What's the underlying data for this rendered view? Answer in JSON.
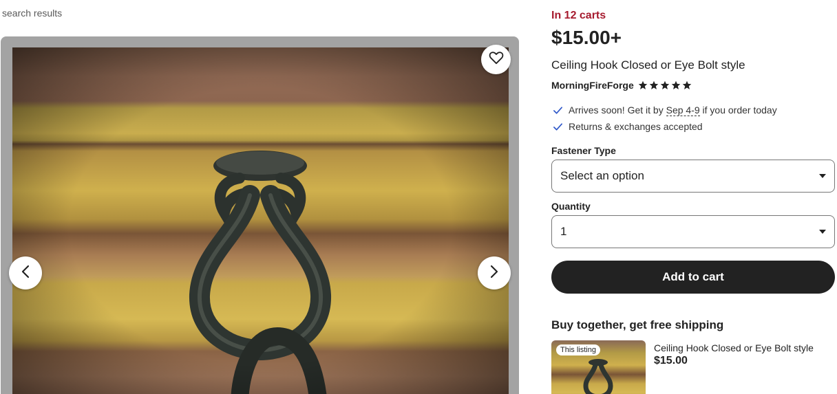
{
  "breadcrumb": "search results",
  "gallery": {
    "favorite_icon": "heart-icon",
    "prev_icon": "chevron-left-icon",
    "next_icon": "chevron-right-icon"
  },
  "listing": {
    "carts_text": "In 12 carts",
    "price": "$15.00+",
    "title": "Ceiling Hook Closed or Eye Bolt style",
    "shop_name": "MorningFireForge",
    "rating_stars": 5
  },
  "perks": {
    "arrives_prefix": "Arrives soon! Get it by ",
    "arrives_date": "Sep 4-9",
    "arrives_suffix": " if you order today",
    "returns": "Returns & exchanges accepted"
  },
  "options": {
    "fastener_label": "Fastener Type",
    "fastener_value": "Select an option",
    "quantity_label": "Quantity",
    "quantity_value": "1"
  },
  "add_to_cart": "Add to cart",
  "bundle": {
    "heading": "Buy together, get free shipping",
    "badge": "This listing",
    "item_title": "Ceiling Hook Closed or Eye Bolt style",
    "item_price": "$15.00"
  },
  "colors": {
    "carts_accent": "#a61a2e",
    "check_blue": "#2f58c9",
    "button_dark": "#222222"
  }
}
